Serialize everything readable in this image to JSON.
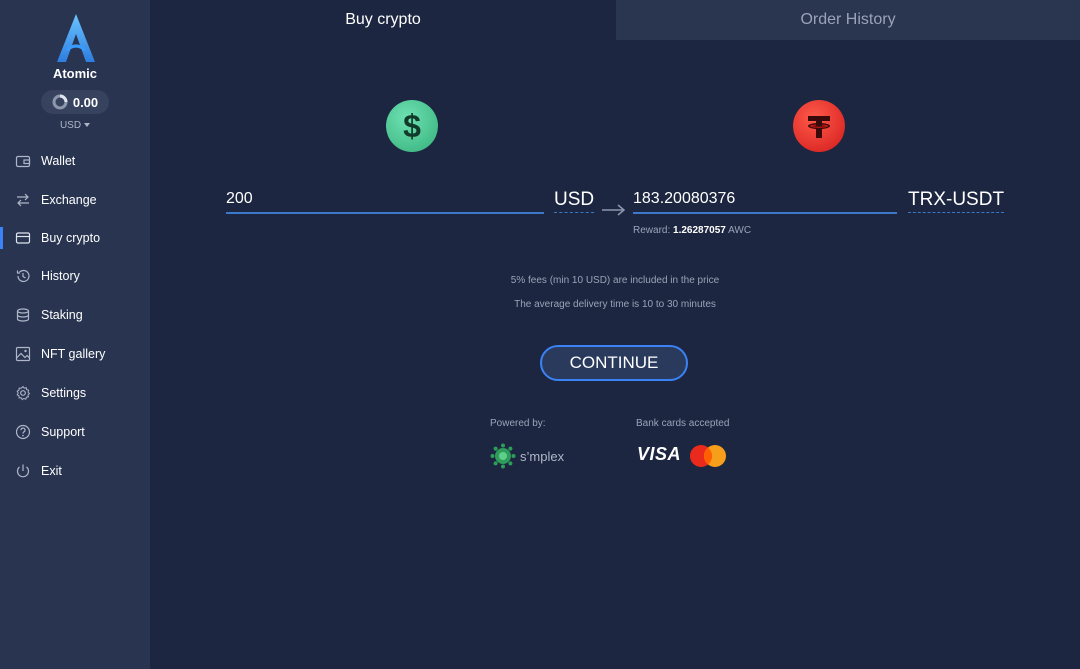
{
  "app": {
    "name": "Atomic"
  },
  "balance": {
    "amount": "0.00",
    "currency": "USD"
  },
  "sidebar": {
    "items": [
      {
        "label": "Wallet",
        "icon": "wallet-icon"
      },
      {
        "label": "Exchange",
        "icon": "exchange-icon"
      },
      {
        "label": "Buy crypto",
        "icon": "card-icon",
        "active": true
      },
      {
        "label": "History",
        "icon": "history-icon"
      },
      {
        "label": "Staking",
        "icon": "staking-icon"
      },
      {
        "label": "NFT gallery",
        "icon": "image-icon"
      },
      {
        "label": "Settings",
        "icon": "gear-icon"
      },
      {
        "label": "Support",
        "icon": "help-icon"
      },
      {
        "label": "Exit",
        "icon": "power-icon"
      }
    ]
  },
  "tabs": [
    {
      "label": "Buy crypto",
      "active": true
    },
    {
      "label": "Order History",
      "active": false
    }
  ],
  "exchange": {
    "from_amount": "200",
    "from_currency": "USD",
    "to_amount": "183.20080376",
    "to_currency": "TRX-USDT",
    "reward_label": "Reward:",
    "reward_value": "1.26287057",
    "reward_unit": "AWC"
  },
  "info": {
    "fees": "5% fees (min 10 USD) are included in the price",
    "delivery": "The average delivery time is 10 to 30 minutes"
  },
  "continue_label": "CONTINUE",
  "footer": {
    "powered_by": "Powered by:",
    "provider": "s’mplex",
    "cards_label": "Bank cards accepted",
    "visa": "VISA"
  },
  "colors": {
    "background": "#1d2640",
    "sidebar": "#283450",
    "accent": "#3b82f6",
    "usd_coin": "#34b07a",
    "tether_coin": "#d11a1a"
  }
}
